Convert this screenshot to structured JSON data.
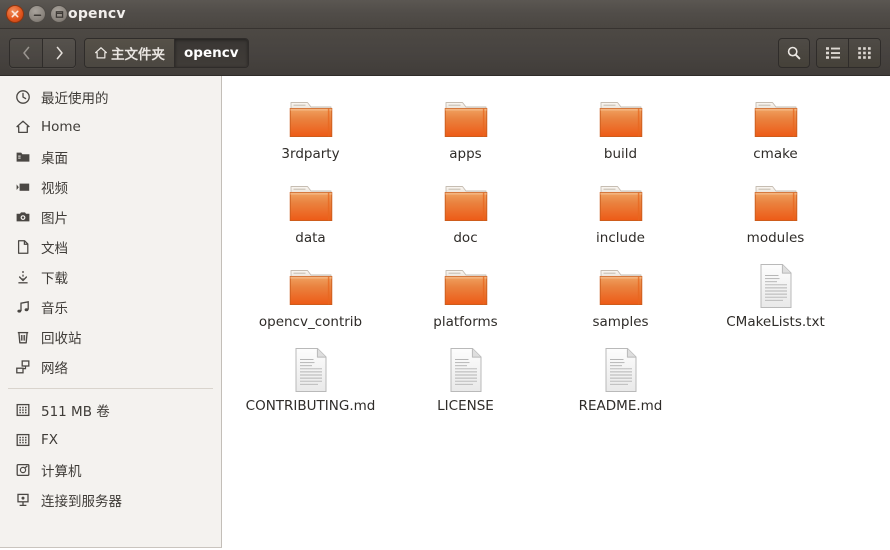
{
  "window": {
    "title": "opencv",
    "controls": [
      {
        "name": "close",
        "label": "关闭"
      },
      {
        "name": "minimize",
        "label": "最小化"
      },
      {
        "name": "maximize",
        "label": "最大化"
      }
    ]
  },
  "toolbar": {
    "back_label": "后退",
    "forward_label": "前进",
    "search_label": "搜索",
    "list_view_label": "列表视图",
    "grid_view_label": "图标视图",
    "breadcrumbs": [
      {
        "label": "主文件夹",
        "icon": "home-icon",
        "active": false
      },
      {
        "label": "opencv",
        "icon": "",
        "active": true
      }
    ]
  },
  "sidebar": {
    "groups": [
      {
        "items": [
          {
            "label": "最近使用的",
            "icon": "clock-icon"
          },
          {
            "label": "Home",
            "icon": "home-icon"
          },
          {
            "label": "桌面",
            "icon": "desktop-folder-icon"
          },
          {
            "label": "视频",
            "icon": "video-icon"
          },
          {
            "label": "图片",
            "icon": "camera-icon"
          },
          {
            "label": "文档",
            "icon": "document-icon"
          },
          {
            "label": "下载",
            "icon": "download-icon"
          },
          {
            "label": "音乐",
            "icon": "music-icon"
          },
          {
            "label": "回收站",
            "icon": "trash-icon"
          },
          {
            "label": "网络",
            "icon": "network-icon"
          }
        ]
      },
      {
        "items": [
          {
            "label": "511 MB 卷",
            "icon": "drive-icon"
          },
          {
            "label": "FX",
            "icon": "drive-icon"
          },
          {
            "label": "计算机",
            "icon": "computer-icon"
          },
          {
            "label": "连接到服务器",
            "icon": "connect-server-icon"
          }
        ]
      }
    ]
  },
  "files": [
    {
      "name": "3rdparty",
      "type": "folder"
    },
    {
      "name": "apps",
      "type": "folder"
    },
    {
      "name": "build",
      "type": "folder"
    },
    {
      "name": "cmake",
      "type": "folder"
    },
    {
      "name": "data",
      "type": "folder"
    },
    {
      "name": "doc",
      "type": "folder"
    },
    {
      "name": "include",
      "type": "folder"
    },
    {
      "name": "modules",
      "type": "folder"
    },
    {
      "name": "opencv_contrib",
      "type": "folder"
    },
    {
      "name": "platforms",
      "type": "folder"
    },
    {
      "name": "samples",
      "type": "folder"
    },
    {
      "name": "CMakeLists.txt",
      "type": "document"
    },
    {
      "name": "CONTRIBUTING.md",
      "type": "document"
    },
    {
      "name": "LICENSE",
      "type": "document"
    },
    {
      "name": "README.md",
      "type": "document"
    }
  ],
  "colors": {
    "titlebar": "#514d49",
    "toolbar": "#474340",
    "sidebar_bg": "#f4f2ef",
    "content_bg": "#ffffff",
    "folder_orange": "#e8762a",
    "close_button": "#e2561e",
    "text_dark": "#2f2c29",
    "text_light": "#f2efec"
  }
}
